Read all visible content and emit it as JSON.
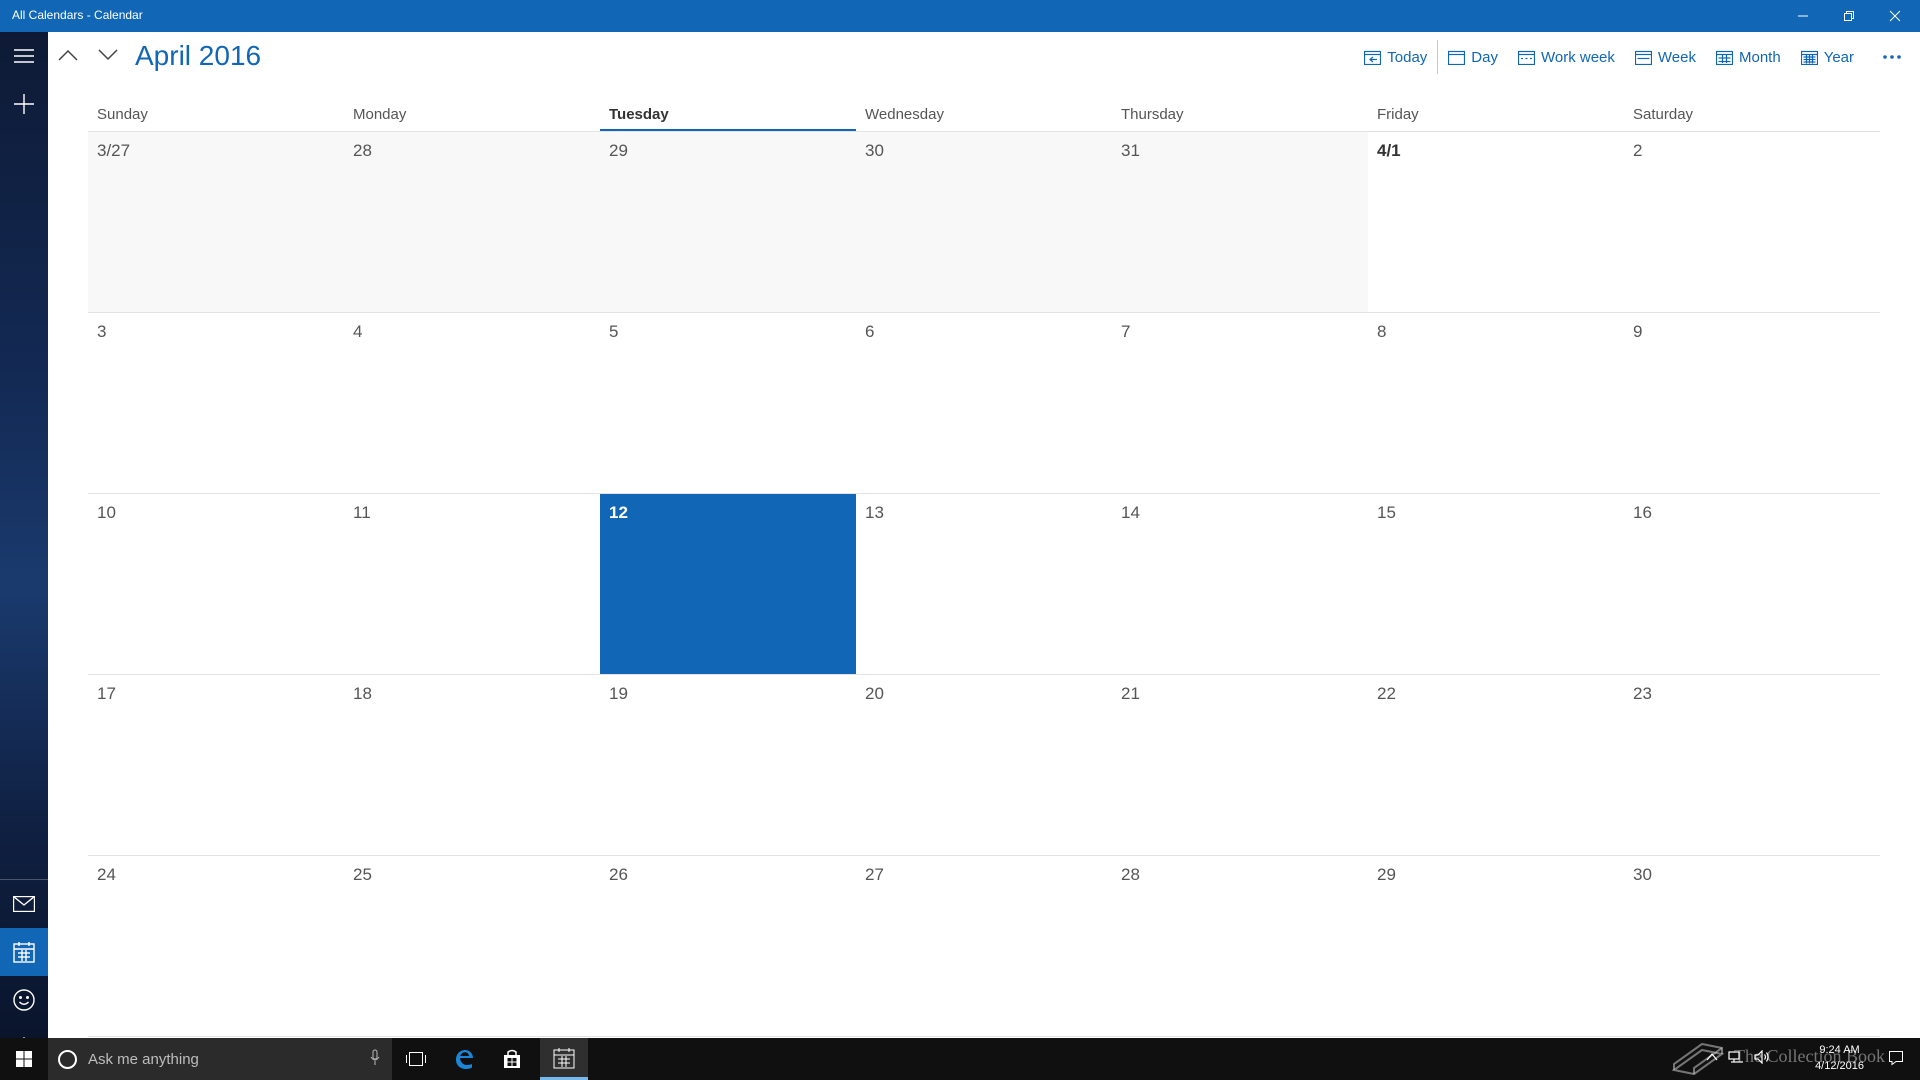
{
  "window": {
    "title": "All Calendars - Calendar"
  },
  "toolbar": {
    "month_title": "April 2016",
    "views": [
      {
        "label": "Today",
        "icon": "today-calendar-icon"
      },
      {
        "label": "Day",
        "icon": "day-calendar-icon"
      },
      {
        "label": "Work week",
        "icon": "work-week-calendar-icon"
      },
      {
        "label": "Week",
        "icon": "week-calendar-icon"
      },
      {
        "label": "Month",
        "icon": "month-calendar-icon"
      },
      {
        "label": "Year",
        "icon": "year-calendar-icon"
      }
    ]
  },
  "calendar": {
    "weekdays": [
      "Sunday",
      "Monday",
      "Tuesday",
      "Wednesday",
      "Thursday",
      "Friday",
      "Saturday"
    ],
    "today_weekday_index": 2,
    "weeks": [
      [
        "3/27",
        "28",
        "29",
        "30",
        "31",
        "4/1",
        "2"
      ],
      [
        "3",
        "4",
        "5",
        "6",
        "7",
        "8",
        "9"
      ],
      [
        "10",
        "11",
        "12",
        "13",
        "14",
        "15",
        "16"
      ],
      [
        "17",
        "18",
        "19",
        "20",
        "21",
        "22",
        "23"
      ],
      [
        "24",
        "25",
        "26",
        "27",
        "28",
        "29",
        "30"
      ]
    ],
    "today_cell": [
      2,
      2
    ],
    "other_month_cells": [
      [
        0,
        0
      ],
      [
        0,
        1
      ],
      [
        0,
        2
      ],
      [
        0,
        3
      ],
      [
        0,
        4
      ]
    ]
  },
  "taskbar": {
    "search_placeholder": "Ask me anything",
    "watermark": "The Collection Book",
    "time": "9:24 AM",
    "date": "4/12/2016"
  },
  "colors": {
    "accent": "#1167b5",
    "taskbar": "#101010"
  }
}
